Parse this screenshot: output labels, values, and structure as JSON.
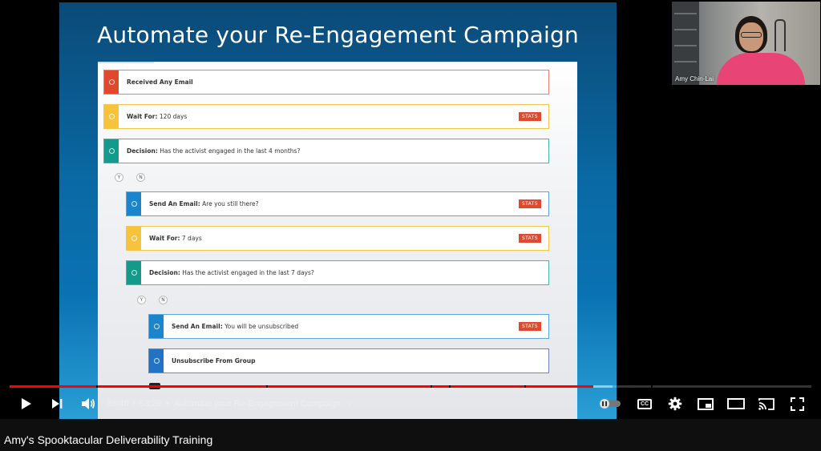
{
  "slide": {
    "title": "Automate your Re-Engagement Campaign",
    "steps": [
      {
        "label": "Received Any Email",
        "detail": "",
        "stats": ""
      },
      {
        "label": "Wait For:",
        "detail": "120 days",
        "stats": "STATS"
      },
      {
        "label": "Decision:",
        "detail": "Has the activist engaged in the last 4 months?",
        "stats": ""
      },
      {
        "label": "Send An Email:",
        "detail": "Are you still there?",
        "stats": "STATS"
      },
      {
        "label": "Wait For:",
        "detail": "7 days",
        "stats": "STATS"
      },
      {
        "label": "Decision:",
        "detail": "Has the activist engaged in the last 7 days?",
        "stats": ""
      },
      {
        "label": "Send An Email:",
        "detail": "You will be unsubscribed",
        "stats": "STATS"
      },
      {
        "label": "Unsubscribe From Group",
        "detail": "",
        "stats": ""
      }
    ],
    "branches": {
      "yes": "Y",
      "no": "N"
    }
  },
  "webcam": {
    "name": "Amy Chin-Lai"
  },
  "player": {
    "current_time": "38:48",
    "time_separator": "/",
    "duration": "53:29",
    "chapter_separator": "•",
    "chapter": "Automate your Re-Engagement Campaign",
    "progress_fraction": 0.7275,
    "buffer_fraction": 0.752,
    "autoplay_on": false,
    "icons": [
      "play-icon",
      "next-icon",
      "volume-icon",
      "chevron-right-icon",
      "autoplay-toggle",
      "captions-icon",
      "settings-gear-icon",
      "miniplayer-icon",
      "theater-mode-icon",
      "cast-icon",
      "fullscreen-icon"
    ],
    "captions_label": "CC",
    "accent_color": "#ff0000"
  },
  "video": {
    "title": "Amy's Spooktacular Deliverability Training"
  }
}
